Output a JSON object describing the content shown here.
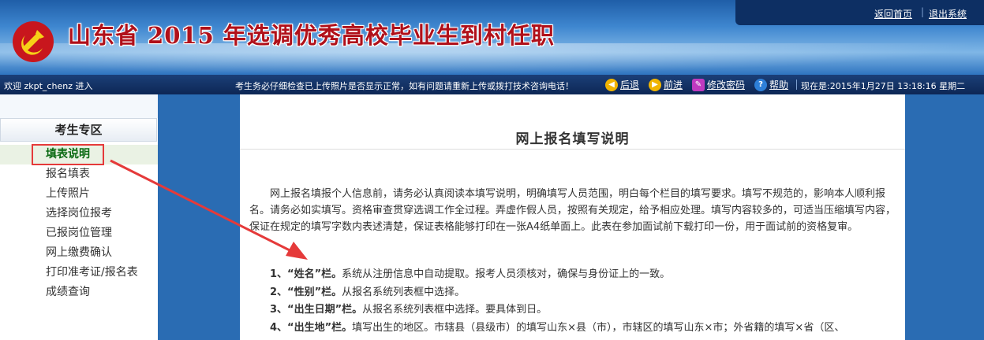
{
  "header": {
    "title": "山东省 2015 年选调优秀高校毕业生到村任职",
    "links": {
      "home": "返回首页",
      "logout": "退出系统",
      "sep": "|"
    }
  },
  "navbar": {
    "welcome": "欢迎 zkpt_chenz 进入",
    "notice": "考生务必仔细检查已上传照片是否显示正常，如有问题请重新上传或拨打技术咨询电话！",
    "back": "后退",
    "forward": "前进",
    "change_password": "修改密码",
    "help": "帮助",
    "time": "现在是:2015年1月27日  13:18:16 星期二"
  },
  "sidebar": {
    "heading": "考生专区",
    "items": [
      {
        "label": "填表说明"
      },
      {
        "label": "报名填表"
      },
      {
        "label": "上传照片"
      },
      {
        "label": "选择岗位报考"
      },
      {
        "label": "已报岗位管理"
      },
      {
        "label": "网上缴费确认"
      },
      {
        "label": "打印准考证/报名表"
      },
      {
        "label": "成绩查询"
      }
    ]
  },
  "content": {
    "title": "网上报名填写说明",
    "intro": "网上报名填报个人信息前，请务必认真阅读本填写说明，明确填写人员范围，明白每个栏目的填写要求。填写不规范的，影响本人顺利报名。请务必如实填写。资格审查贯穿选调工作全过程。弄虚作假人员，按照有关规定，给予相应处理。填写内容较多的，可适当压缩填写内容，保证在规定的填写字数内表述清楚，保证表格能够打印在一张A4纸单面上。此表在参加面试前下载打印一份，用于面试前的资格复审。",
    "items": [
      {
        "num": "1、",
        "field": "“姓名”栏。",
        "text": "系统从注册信息中自动提取。报考人员须核对，确保与身份证上的一致。"
      },
      {
        "num": "2、",
        "field": "“性别”栏。",
        "text": "从报名系统列表框中选择。"
      },
      {
        "num": "3、",
        "field": "“出生日期”栏。",
        "text": "从报名系统列表框中选择。要具体到日。"
      },
      {
        "num": "4、",
        "field": "“出生地”栏。",
        "text": "填写出生的地区。市辖县（县级市）的填写山东×县（市），市辖区的填写山东×市；外省籍的填写×省（区、"
      }
    ]
  },
  "colors": {
    "annotation": "#e53a3a",
    "active_item": "#0a6a12",
    "title_red": "#b0101a"
  }
}
